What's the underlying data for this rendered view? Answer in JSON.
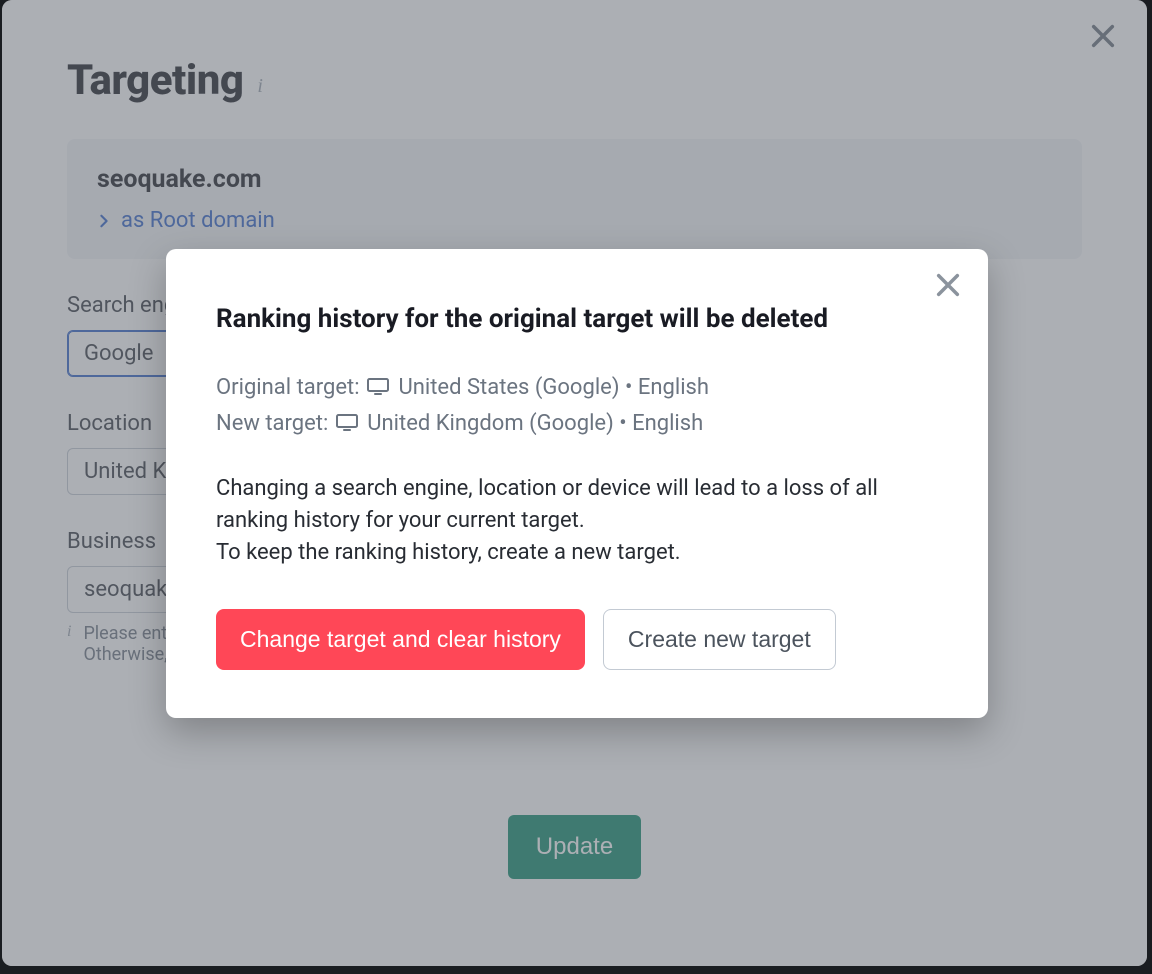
{
  "panel": {
    "title": "Targeting",
    "domain_card": {
      "domain": "seoquake.com",
      "root_label": "as Root domain"
    },
    "labels": {
      "search_engine": "Search engine",
      "location": "Location",
      "business": "Business"
    },
    "fields": {
      "search_engine": "Google",
      "location": "United Kingdom",
      "business": "seoquake"
    },
    "note_line1": "Please enter your business name exactly as it appears in Google.",
    "note_line2": "Otherwise, results may be inaccurate.",
    "update_button": "Update"
  },
  "modal": {
    "title": "Ranking history for the original target will be deleted",
    "original_label": "Original target:",
    "original_value": "United States (Google) • English",
    "new_label": "New target:",
    "new_value": "United Kingdom (Google) • English",
    "warning_line1": "Changing a search engine, location or device will lead to a loss of all ranking history for your current target.",
    "warning_line2": "To keep the ranking history, create a new target.",
    "danger_button": "Change target and clear history",
    "secondary_button": "Create new target"
  }
}
